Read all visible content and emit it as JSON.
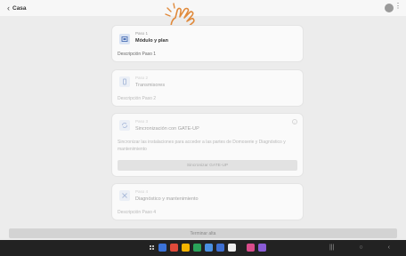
{
  "header": {
    "back_icon": "chevron-left-icon",
    "title": "Casa"
  },
  "steps": [
    {
      "paso": "Paso 1",
      "title": "Módulo y plan",
      "desc": "Descripción Paso 1",
      "icon": "module-icon"
    },
    {
      "paso": "Paso 2",
      "title": "Transmisores",
      "desc": "Descripción Paso 2",
      "icon": "transmitter-icon"
    },
    {
      "paso": "Paso 3",
      "title": "Sincronización con GATE-UP",
      "desc": "Sincronizar las instalaciones para acceder a las partes de Domoserie y Diagnóstico y mantenimiento",
      "button": "Sincronizar GATE-UP",
      "icon": "sync-icon"
    },
    {
      "paso": "Paso 4",
      "title": "Diagnóstico y mantenimiento",
      "desc": "Descripción Paso 4",
      "icon": "tools-icon"
    }
  ],
  "footer": {
    "finish_label": "Terminar alta"
  },
  "colors": {
    "background": "#ececec",
    "card": "#fafafa",
    "accent": "#d9e3f3",
    "hand": "#e08a3c"
  }
}
